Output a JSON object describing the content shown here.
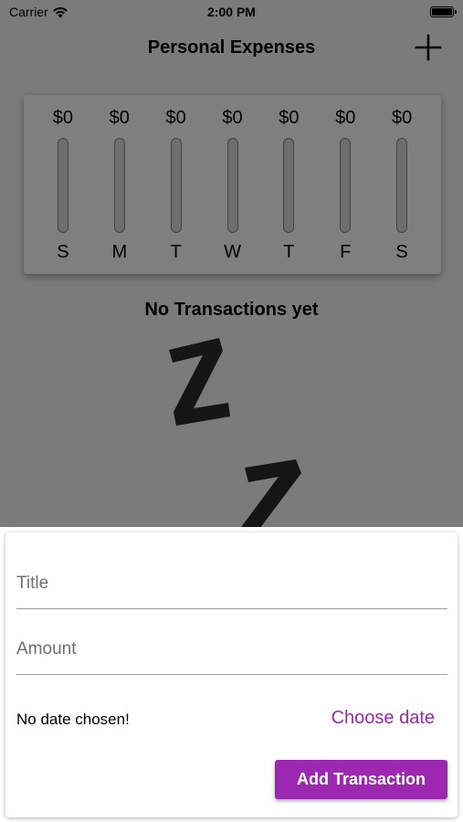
{
  "status_bar": {
    "carrier": "Carrier",
    "time": "2:00 PM"
  },
  "app_bar": {
    "title": "Personal Expenses",
    "add_icon": "plus-icon"
  },
  "chart": {
    "days": [
      {
        "day": "S",
        "amount": "$0",
        "fraction": 0
      },
      {
        "day": "M",
        "amount": "$0",
        "fraction": 0
      },
      {
        "day": "T",
        "amount": "$0",
        "fraction": 0
      },
      {
        "day": "W",
        "amount": "$0",
        "fraction": 0
      },
      {
        "day": "T",
        "amount": "$0",
        "fraction": 0
      },
      {
        "day": "F",
        "amount": "$0",
        "fraction": 0
      },
      {
        "day": "S",
        "amount": "$0",
        "fraction": 0
      }
    ]
  },
  "empty_state": {
    "title": "No Transactions yet",
    "image": "zzz-sleeping-image"
  },
  "new_transaction": {
    "title_placeholder": "Title",
    "amount_placeholder": "Amount",
    "no_date_text": "No date chosen!",
    "choose_date_label": "Choose date",
    "submit_label": "Add Transaction"
  },
  "colors": {
    "primary": "#9c27b0",
    "overlay": "rgba(0,0,0,0.5)"
  }
}
